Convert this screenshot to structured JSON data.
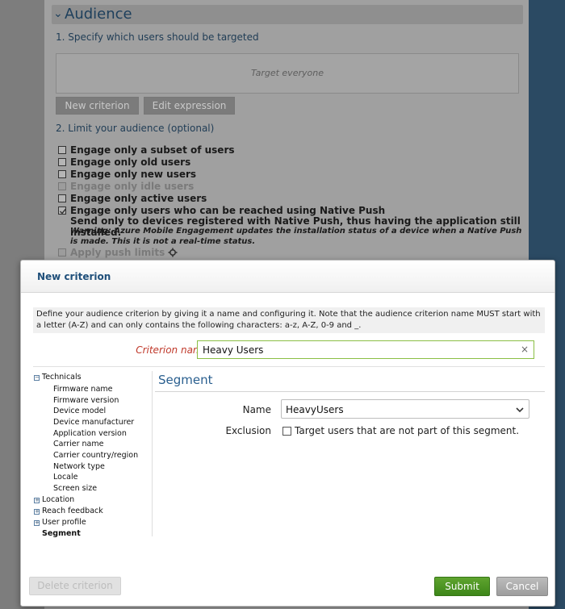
{
  "background": {
    "audience_title": "Audience",
    "step1": "1. Specify which users should be targeted",
    "target_placeholder": "Target everyone",
    "new_criterion_button": "New criterion",
    "edit_expression_button": "Edit expression",
    "step2": "2. Limit your audience (optional)",
    "options": [
      {
        "label": "Engage only a subset of users",
        "enabled": true
      },
      {
        "label": "Engage only old users",
        "enabled": true
      },
      {
        "label": "Engage only new users",
        "enabled": true
      },
      {
        "label": "Engage only idle users",
        "enabled": false
      },
      {
        "label": "Engage only active users",
        "enabled": true
      },
      {
        "label": "Engage only users who can be reached using Native Push",
        "enabled": true,
        "checked": true
      }
    ],
    "native_push_sub": "Send only to devices registered with Native Push, thus having the application still installed.",
    "native_push_warning": "Warning: Azure Mobile Engagement updates the installation status of a device when a Native Push is made. This it is not a real-time status.",
    "apply_push_limits": "Apply push limits"
  },
  "modal": {
    "title": "New criterion",
    "info": "Define your audience criterion by giving it a name and configuring it. Note that the audience criterion name MUST start with a letter (A-Z) and can only contains the following characters: a-z, A-Z, 0-9 and _.",
    "criterion_name_label": "Criterion name",
    "criterion_name_value": "Heavy Users",
    "clear_glyph": "×",
    "tree": {
      "technicals": "Technicals",
      "technicals_children": [
        "Firmware name",
        "Firmware version",
        "Device model",
        "Device manufacturer",
        "Application version",
        "Carrier name",
        "Carrier country/region",
        "Network type",
        "Locale",
        "Screen size"
      ],
      "location": "Location",
      "reach_feedback": "Reach feedback",
      "user_profile": "User profile",
      "segment": "Segment"
    },
    "segment_title": "Segment",
    "name_label": "Name",
    "name_value": "HeavyUsers",
    "exclusion_label": "Exclusion",
    "exclusion_text": "Target users that are not part of this segment.",
    "delete_button": "Delete criterion",
    "submit_button": "Submit",
    "cancel_button": "Cancel"
  },
  "colors": {
    "accent": "#2a5f8f",
    "submit": "#4a9424",
    "required_label": "#c0392b"
  }
}
